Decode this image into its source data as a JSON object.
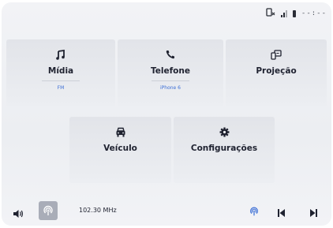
{
  "status": {
    "time": "--:--",
    "icons": [
      "phone-link-icon",
      "signal-icon",
      "battery-icon"
    ]
  },
  "tiles": {
    "midia": {
      "icon": "music-note-icon",
      "label": "Mídia",
      "sub": "FM"
    },
    "telefone": {
      "icon": "phone-icon",
      "label": "Telefone",
      "sub": "iPhone 6"
    },
    "projecao": {
      "icon": "projection-icon",
      "label": "Projeção"
    },
    "veiculo": {
      "icon": "car-icon",
      "label": "Veículo"
    },
    "configuracoes": {
      "icon": "gear-icon",
      "label": "Configurações"
    }
  },
  "bottom_bar": {
    "volume_icon": "speaker-icon",
    "source_icon": "radio-antenna-icon",
    "frequency": "102.30 MHz",
    "controls": [
      "radio-source-icon",
      "previous-icon",
      "next-icon"
    ]
  },
  "colors": {
    "accent": "#3d6fd6",
    "text": "#1f2230",
    "background": "#eceef2"
  }
}
